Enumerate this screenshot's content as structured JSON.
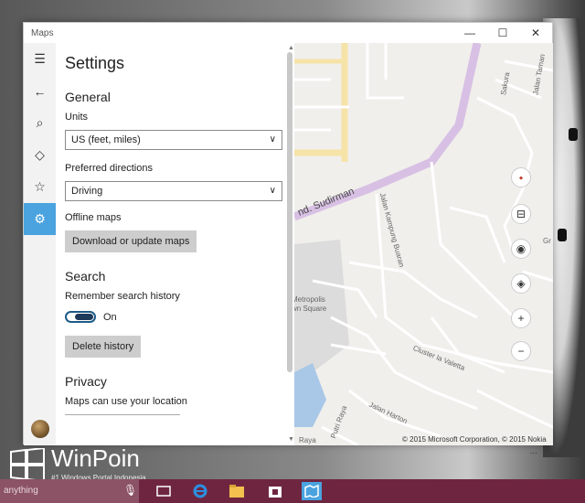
{
  "window": {
    "title": "Maps",
    "controls": {
      "minimize": "—",
      "maximize": "☐",
      "close": "✕"
    }
  },
  "rail": {
    "items": [
      {
        "name": "menu",
        "icon": "hamburger-icon",
        "glyph": "☰"
      },
      {
        "name": "back",
        "icon": "back-arrow-icon",
        "glyph": "←"
      },
      {
        "name": "search",
        "icon": "search-icon",
        "glyph": "⌕"
      },
      {
        "name": "directions",
        "icon": "directions-icon",
        "glyph": "◇"
      },
      {
        "name": "favorites",
        "icon": "star-icon",
        "glyph": "☆"
      },
      {
        "name": "settings",
        "icon": "gear-icon",
        "glyph": "⚙"
      }
    ]
  },
  "settings": {
    "title": "Settings",
    "general": {
      "heading": "General",
      "units_label": "Units",
      "units_value": "US (feet, miles)",
      "directions_label": "Preferred directions",
      "directions_value": "Driving",
      "offline_label": "Offline maps",
      "offline_button": "Download or update maps"
    },
    "search": {
      "heading": "Search",
      "history_label": "Remember search history",
      "history_state": "On",
      "delete_button": "Delete history"
    },
    "privacy": {
      "heading": "Privacy",
      "location_label": "Maps can use your location"
    }
  },
  "map": {
    "road_sudirman": "nd. Sudirman",
    "labels": {
      "jalan_taman": "Jalan Taman",
      "sakura": "Sakura",
      "kampung_buaran": "Jalan Kampung Buaran",
      "metropolis": "Metropolis",
      "town_square": "wn Square",
      "cluster_la_valetta": "Cluster la Valetta",
      "jalan_hartono": "Jalan Harton",
      "putri_raya": "Putri Raya",
      "raya": "Raya",
      "gr": "Gr"
    },
    "copyright": "© 2015 Microsoft Corporation, © 2015 Nokia",
    "more": "...",
    "controls": [
      {
        "name": "compass",
        "icon": "compass-icon",
        "glyph": "⬩"
      },
      {
        "name": "tilt",
        "icon": "tilt-icon",
        "glyph": "⊟"
      },
      {
        "name": "location",
        "icon": "locate-icon",
        "glyph": "◉"
      },
      {
        "name": "layers",
        "icon": "layers-icon",
        "glyph": "◈"
      },
      {
        "name": "zoom-in",
        "icon": "plus-icon",
        "glyph": "+"
      },
      {
        "name": "zoom-out",
        "icon": "minus-icon",
        "glyph": "−"
      }
    ]
  },
  "watermark": {
    "title": "WinPoin",
    "subtitle": "#1 Windows Portal Indonesia"
  },
  "taskbar": {
    "search_text": "anything",
    "colors": {
      "bar": "#6e2640",
      "search": "#8c5266"
    }
  }
}
